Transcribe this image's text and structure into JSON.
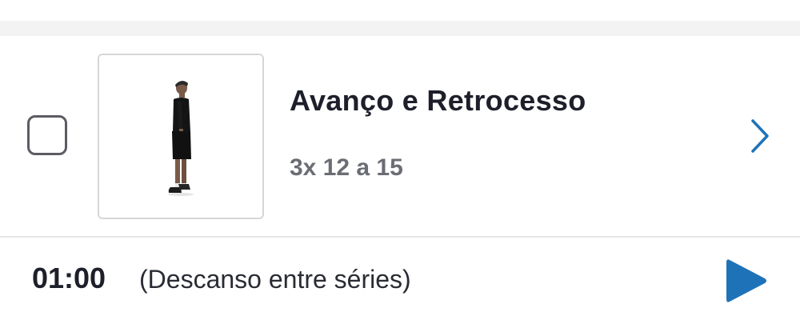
{
  "exercise": {
    "title": "Avanço e Retrocesso",
    "sets": "3x 12 a 15",
    "completed": false,
    "thumbnail_icon": "person-standing-icon"
  },
  "rest": {
    "time": "01:00",
    "label": "(Descanso entre séries)"
  },
  "icons": {
    "checkbox": "checkbox-icon",
    "chevron": "chevron-right-icon",
    "play": "play-icon"
  },
  "colors": {
    "accent": "#1e73b8",
    "title_text": "#1d1f2a",
    "secondary_text": "#6b6d74",
    "separator": "#f3f3f4"
  }
}
